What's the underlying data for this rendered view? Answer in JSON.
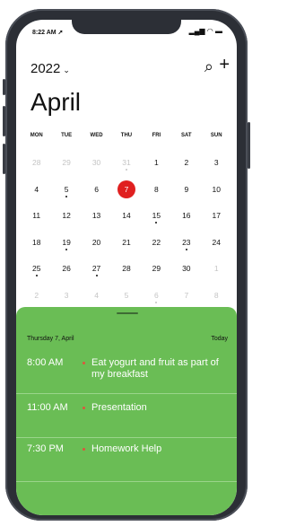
{
  "status": {
    "time": "8:22 AM",
    "location_icon": "location-arrow-icon",
    "signal_icon": "signal-icon",
    "wifi_icon": "wifi-icon",
    "battery_icon": "battery-icon"
  },
  "header": {
    "year": "2022",
    "chevron": "⌄",
    "search_icon": "⌕",
    "add_icon": "+"
  },
  "month": "April",
  "weekdays": [
    "MON",
    "TUE",
    "WED",
    "THU",
    "FRI",
    "SAT",
    "SUN"
  ],
  "weeks": [
    [
      {
        "d": "28",
        "o": true
      },
      {
        "d": "29",
        "o": true
      },
      {
        "d": "30",
        "o": true
      },
      {
        "d": "31",
        "o": true,
        "dot": true
      },
      {
        "d": "1"
      },
      {
        "d": "2"
      },
      {
        "d": "3"
      }
    ],
    [
      {
        "d": "4"
      },
      {
        "d": "5",
        "dot": true
      },
      {
        "d": "6"
      },
      {
        "d": "7",
        "today": true
      },
      {
        "d": "8"
      },
      {
        "d": "9"
      },
      {
        "d": "10"
      }
    ],
    [
      {
        "d": "11"
      },
      {
        "d": "12"
      },
      {
        "d": "13"
      },
      {
        "d": "14"
      },
      {
        "d": "15",
        "dot": true
      },
      {
        "d": "16"
      },
      {
        "d": "17"
      }
    ],
    [
      {
        "d": "18"
      },
      {
        "d": "19",
        "dot": true
      },
      {
        "d": "20"
      },
      {
        "d": "21"
      },
      {
        "d": "22"
      },
      {
        "d": "23",
        "dot": true
      },
      {
        "d": "24"
      }
    ],
    [
      {
        "d": "25",
        "dot": true
      },
      {
        "d": "26"
      },
      {
        "d": "27",
        "dot": true
      },
      {
        "d": "28"
      },
      {
        "d": "29"
      },
      {
        "d": "30"
      },
      {
        "d": "1",
        "o": true
      }
    ],
    [
      {
        "d": "2",
        "o": true
      },
      {
        "d": "3",
        "o": true
      },
      {
        "d": "4",
        "o": true
      },
      {
        "d": "5",
        "o": true
      },
      {
        "d": "6",
        "o": true,
        "dot": true
      },
      {
        "d": "7",
        "o": true
      },
      {
        "d": "8",
        "o": true
      }
    ]
  ],
  "sheet": {
    "date_label": "Thursday 7, April",
    "today_label": "Today",
    "events": [
      {
        "time": "8:00 AM",
        "title": "Eat yogurt and fruit as part of my breakfast"
      },
      {
        "time": "11:00 AM",
        "title": "Presentation"
      },
      {
        "time": "7:30 PM",
        "title": "Homework Help"
      }
    ]
  },
  "colors": {
    "sheet_bg": "#6abd55",
    "today_circle": "#e02020",
    "event_bullet": "#e0533d"
  }
}
